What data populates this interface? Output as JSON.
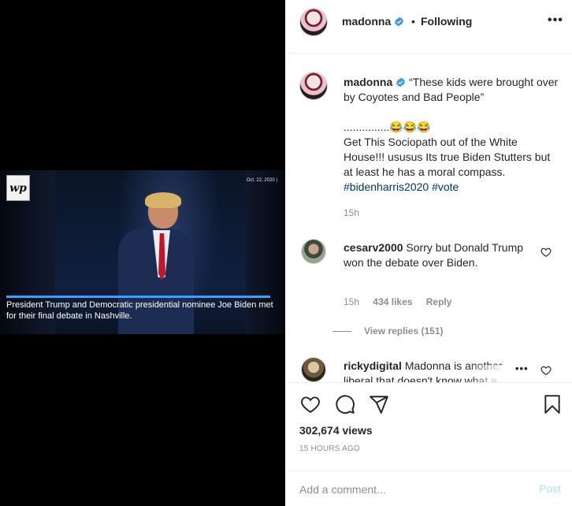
{
  "media": {
    "logo_text": "wp",
    "date_stamp": "Oct. 22, 2020 |",
    "caption": "President Trump and Democratic presidential nominee Joe Biden met for their final debate in Nashville."
  },
  "header": {
    "username": "madonna",
    "separator": "•",
    "following_label": "Following",
    "more_label": "•••"
  },
  "post": {
    "username": "madonna",
    "quote": "“These kids were brought over by Coyotes and Bad People”",
    "dots": "...............",
    "emojis": "😂😂😂",
    "body": "Get This Sociopath out of the White House!!! ususus Its true Biden Stutters but at least he has a moral compass.",
    "hashtags": [
      "#bidenharris2020",
      "#vote"
    ],
    "time": "15h"
  },
  "comments": [
    {
      "username": "cesarv2000",
      "text": "Sorry but Donald Trump won the debate over Biden.",
      "time": "15h",
      "likes": "434 likes",
      "reply_label": "Reply",
      "view_replies": "View replies (151)"
    },
    {
      "username": "rickydigital",
      "text": "Madonna is another liberal that doesn't know what a",
      "more_label": "•••"
    }
  ],
  "actions": {
    "views": "302,674 views",
    "posted": "15 HOURS AGO"
  },
  "add_comment": {
    "placeholder": "Add a comment...",
    "post_label": "Post"
  },
  "colors": {
    "verified": "#3897f0",
    "hashtag": "#00376b",
    "muted": "#8e8e8e",
    "post_disabled": "#b2dffc"
  }
}
